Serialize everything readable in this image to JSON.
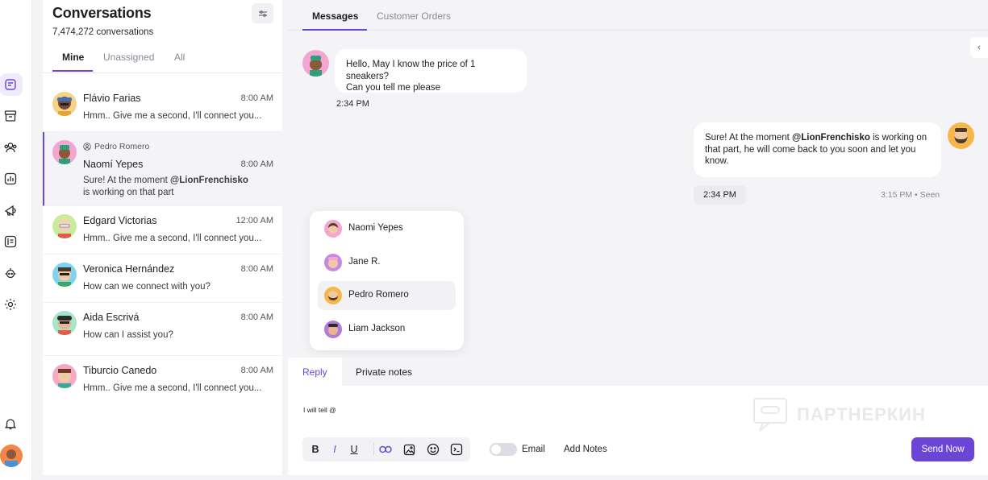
{
  "rail": {
    "icons": [
      "inbox-icon",
      "archive-icon",
      "contacts-icon",
      "reports-icon",
      "campaigns-icon",
      "knowledge-icon",
      "bot-icon",
      "settings-icon",
      "bell-icon"
    ]
  },
  "conversations": {
    "title": "Conversations",
    "count": "7,474,272 conversations",
    "tabs": [
      "Mine",
      "Unassigned",
      "All"
    ],
    "items": [
      {
        "name": "Flávio Farias",
        "time": "8:00 AM",
        "preview": "Hmm.. Give me a second, I'll connect you..."
      },
      {
        "assignee": "Pedro Romero",
        "name": "Naomí Yepes",
        "time": "8:00 AM",
        "preview_prefix": "Sure! At the moment ",
        "preview_mention": "@LionFrenchisko",
        "preview_line2": "is working on that part"
      },
      {
        "name": "Edgard Victorias",
        "time": "12:00 AM",
        "preview": "Hmm.. Give me a second, I'll connect you..."
      },
      {
        "name": "Veronica Hernández",
        "time": "8:00 AM",
        "preview": "How can we connect with you?"
      },
      {
        "name": "Aida Escrivá",
        "time": "8:00 AM",
        "preview": "How can I assist you?"
      },
      {
        "name": "Tiburcio Canedo",
        "time": "8:00 AM",
        "preview": "Hmm.. Give me a second, I'll connect you..."
      }
    ]
  },
  "chat": {
    "tabs": [
      "Messages",
      "Customer Orders"
    ],
    "incoming": {
      "line1": "Hello, May I know the price of 1 sneakers?",
      "line2": "Can you tell me please",
      "time": "2:34 PM"
    },
    "outgoing": {
      "prefix": "Sure! At the moment ",
      "mention": "@LionFrenchisko",
      "suffix": " is working on that part, he will come back to you soon and let you know.",
      "time_pill": "2:34 PM",
      "seen": "3:15 PM • Seen"
    },
    "mentions": [
      "Naomi Yepes",
      "Jane R.",
      "Pedro Romero",
      "Liam Jackson"
    ]
  },
  "composer": {
    "tabs": [
      "Reply",
      "Private notes"
    ],
    "text": "I will tell @",
    "format": {
      "bold": "B",
      "italic": "I",
      "underline": "U"
    },
    "email_label": "Email",
    "add_notes": "Add Notes",
    "send": "Send Now",
    "watermark": "ПАРТНЕРКИН"
  },
  "colors": {
    "accent": "#6b46d6",
    "background": "#f4f4f6"
  }
}
